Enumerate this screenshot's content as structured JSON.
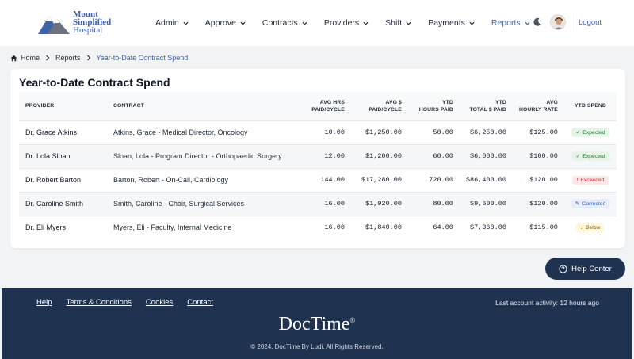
{
  "header": {
    "logo": {
      "line1": "Mount",
      "line2": "Simplified",
      "line3": "Hospital"
    },
    "nav": [
      {
        "label": "Admin",
        "active": false
      },
      {
        "label": "Approve",
        "active": false
      },
      {
        "label": "Contracts",
        "active": false
      },
      {
        "label": "Providers",
        "active": false
      },
      {
        "label": "Shift",
        "active": false
      },
      {
        "label": "Payments",
        "active": false
      },
      {
        "label": "Reports",
        "active": true
      }
    ],
    "logout_label": "Logout"
  },
  "breadcrumb": {
    "home": "Home",
    "reports": "Reports",
    "current": "Year-to-Date Contract Spend"
  },
  "page": {
    "title": "Year-to-Date Contract Spend",
    "columns": {
      "provider": "PROVIDER",
      "contract": "CONTRACT",
      "avg_hrs_1": "AVG HRS",
      "avg_hrs_2": "PAID/CYCLE",
      "avg_paid_1": "AVG $",
      "avg_paid_2": "PAID/CYCLE",
      "ytd_hours_1": "YTD",
      "ytd_hours_2": "HOURS PAID",
      "ytd_total_1": "YTD",
      "ytd_total_2": "TOTAL $ PAID",
      "avg_rate_1": "AVG",
      "avg_rate_2": "HOURLY RATE",
      "ytd_spend": "YTD SPEND"
    },
    "rows": [
      {
        "provider": "Dr. Grace Atkins",
        "contract": "Atkins, Grace - Medical Director, Oncology",
        "avg_hrs": "10.00",
        "avg_paid": "$1,250.00",
        "ytd_hours": "50.00",
        "ytd_total": "$6,250.00",
        "avg_rate": "$125.00",
        "status": "Expected",
        "status_icon": "✓"
      },
      {
        "provider": "Dr. Lola Sloan",
        "contract": "Sloan, Lola - Program Director - Orthopaedic Surgery",
        "avg_hrs": "12.00",
        "avg_paid": "$1,200.00",
        "ytd_hours": "60.00",
        "ytd_total": "$6,000.00",
        "avg_rate": "$100.00",
        "status": "Expected",
        "status_icon": "✓"
      },
      {
        "provider": "Dr. Robert Barton",
        "contract": "Barton, Robert - On-Call, Cardiology",
        "avg_hrs": "144.00",
        "avg_paid": "$17,280.00",
        "ytd_hours": "720.00",
        "ytd_total": "$86,400.00",
        "avg_rate": "$120.00",
        "status": "Exceeded",
        "status_icon": "!"
      },
      {
        "provider": "Dr. Caroline Smith",
        "contract": "Smith, Caroline -  Chair, Surgical Services",
        "avg_hrs": "16.00",
        "avg_paid": "$1,920.00",
        "ytd_hours": "80.00",
        "ytd_total": "$9,600.00",
        "avg_rate": "$120.00",
        "status": "Corrected",
        "status_icon": "✎"
      },
      {
        "provider": "Dr. Eli Myers",
        "contract": "Myers, Eli - Faculty, Internal Medicine",
        "avg_hrs": "16.00",
        "avg_paid": "$1,840.00",
        "ytd_hours": "64.00",
        "ytd_total": "$7,360.00",
        "avg_rate": "$115.00",
        "status": "Below",
        "status_icon": "↓"
      }
    ]
  },
  "help": {
    "label": "Help Center"
  },
  "footer": {
    "links": [
      "Help",
      "Terms & Conditions",
      "Cookies",
      "Contact"
    ],
    "activity": "Last account activity: 12 hours ago",
    "brand": "DocTime",
    "brand_mark": "®",
    "copyright": "© 2024. DocTime By Ludi. All Rights Reserved."
  },
  "colors": {
    "accent": "#3f63a7",
    "navy": "#1f3350",
    "expected": "#2e7d32",
    "exceeded": "#c62828",
    "corrected": "#2f5fb3",
    "below": "#6b5a12"
  }
}
